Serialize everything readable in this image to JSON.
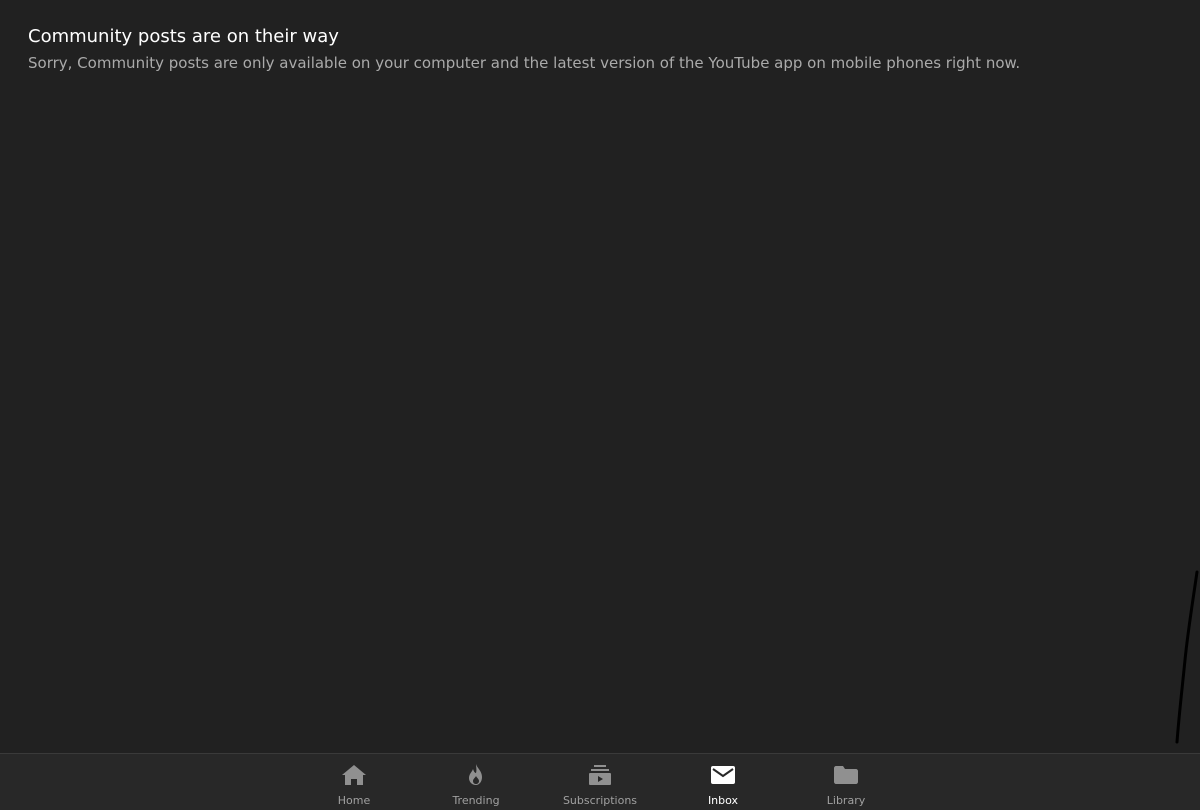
{
  "message": {
    "title": "Community posts are on their way",
    "body": "Sorry, Community posts are only available on your computer and the latest version of the YouTube app on mobile phones right now."
  },
  "bottom_nav": {
    "active": "Inbox",
    "items": [
      {
        "label": "Home",
        "icon": "home-icon"
      },
      {
        "label": "Trending",
        "icon": "flame-icon"
      },
      {
        "label": "Subscriptions",
        "icon": "subscriptions-icon"
      },
      {
        "label": "Inbox",
        "icon": "mail-icon"
      },
      {
        "label": "Library",
        "icon": "folder-icon"
      }
    ]
  },
  "colors": {
    "background": "#212121",
    "nav_background": "#282828",
    "title_text": "#ffffff",
    "body_text": "#aaaaaa",
    "inactive_icon": "#909090",
    "active_icon": "#ffffff"
  }
}
